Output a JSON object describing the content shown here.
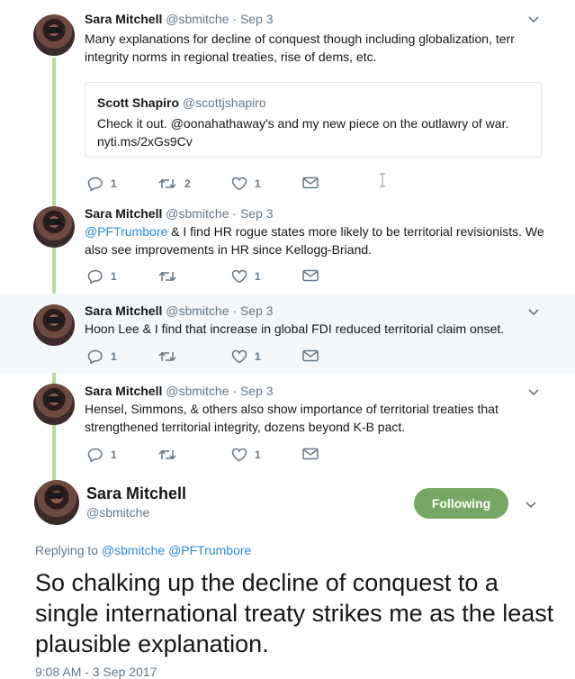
{
  "colors": {
    "accent_green": "#77a765",
    "link_blue": "#2a8bd8",
    "thread_line": "#b9d8a8",
    "muted": "#657786"
  },
  "tweets": [
    {
      "name": "Sara Mitchell",
      "handle": "@sbmitche",
      "sep": "·",
      "date": "Sep 3",
      "lines": [
        "Many explanations for decline of conquest though including globalization, terr",
        "integrity norms in regional treaties, rise of dems, etc."
      ],
      "quote": {
        "name": "Scott Shapiro",
        "handle": "@scottjshapiro",
        "line1": "Check it out. @oonahathaway's and my new piece on the outlawry of war.",
        "line2": "nyti.ms/2xGs9Cv"
      },
      "replies": "1",
      "retweets": "2",
      "likes": "1"
    },
    {
      "name": "Sara Mitchell",
      "handle": "@sbmitche",
      "sep": "·",
      "date": "Sep 3",
      "mention": "@PFTrumbore",
      "line1_rest": " & I find HR rogue states more likely to be territorial revisionists. We",
      "line2": "also see improvements in HR since Kellogg-Briand.",
      "replies": "1",
      "retweets": "",
      "likes": "1"
    },
    {
      "name": "Sara Mitchell",
      "handle": "@sbmitche",
      "sep": "·",
      "date": "Sep 3",
      "line1": "Hoon Lee & I find that increase in global FDI reduced territorial claim onset.",
      "replies": "1",
      "retweets": "",
      "likes": "1"
    },
    {
      "name": "Sara Mitchell",
      "handle": "@sbmitche",
      "sep": "·",
      "date": "Sep 3",
      "line1": "Hensel, Simmons, & others also show importance of territorial treaties that",
      "line2": "strengthened territorial integrity, dozens beyond K-B pact.",
      "replies": "1",
      "retweets": "",
      "likes": "1"
    }
  ],
  "main": {
    "name": "Sara Mitchell",
    "handle": "@sbmitche",
    "follow_label": "Following",
    "replying_prefix": "Replying to ",
    "replying_1": "@sbmitche",
    "replying_2": "@PFTrumbore",
    "text": "So chalking up the decline of conquest to a single international treaty strikes me as the least plausible explanation.",
    "timestamp": "9:08 AM - 3 Sep 2017"
  },
  "icons": [
    "reply-icon",
    "retweet-icon",
    "like-icon",
    "dm-icon",
    "chevron-down-icon",
    "text-cursor-icon"
  ]
}
